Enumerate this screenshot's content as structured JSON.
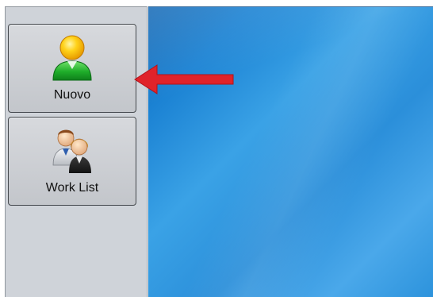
{
  "sidebar": {
    "items": [
      {
        "label": "Nuovo",
        "icon": "user-icon"
      },
      {
        "label": "Work List",
        "icon": "users-icon"
      }
    ]
  },
  "annotation": {
    "arrow_color": "#e0232a",
    "arrow_icon": "arrow-left-icon"
  },
  "colors": {
    "sidebar_bg": "#cfd3d9",
    "desktop_bg": "#2b8fda"
  }
}
